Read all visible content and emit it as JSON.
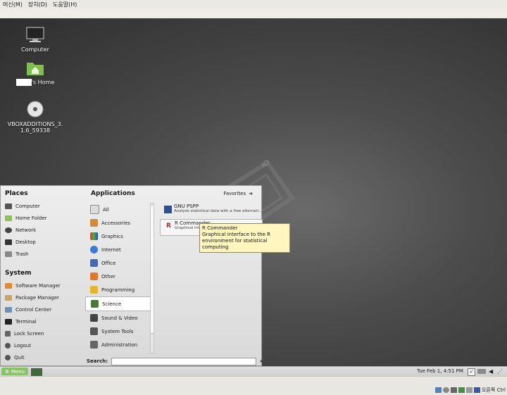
{
  "vbox_menu": [
    "머신(M)",
    "장치(D)",
    "도움말(H)"
  ],
  "desktop_icons": [
    {
      "label": "Computer",
      "icon": "monitor-icon"
    },
    {
      "label": "'s Home",
      "icon": "home-folder-icon"
    },
    {
      "label": "VBOXADDITIONS_3.1.6_59338",
      "icon": "cd-icon"
    }
  ],
  "places": {
    "title": "Places",
    "items": [
      {
        "label": "Computer",
        "icon": "computer-icon"
      },
      {
        "label": "Home Folder",
        "icon": "home-folder-icon"
      },
      {
        "label": "Network",
        "icon": "network-icon"
      },
      {
        "label": "Desktop",
        "icon": "desktop-icon"
      },
      {
        "label": "Trash",
        "icon": "trash-icon"
      }
    ]
  },
  "system": {
    "title": "System",
    "items": [
      {
        "label": "Software Manager",
        "icon": "software-manager-icon"
      },
      {
        "label": "Package Manager",
        "icon": "package-manager-icon"
      },
      {
        "label": "Control Center",
        "icon": "control-center-icon"
      },
      {
        "label": "Terminal",
        "icon": "terminal-icon"
      },
      {
        "label": "Lock Screen",
        "icon": "lock-icon"
      },
      {
        "label": "Logout",
        "icon": "logout-icon"
      },
      {
        "label": "Quit",
        "icon": "quit-icon"
      }
    ]
  },
  "applications": {
    "title": "Applications",
    "favorites_label": "Favorites",
    "categories": [
      {
        "label": "All",
        "selected": false
      },
      {
        "label": "Accessories",
        "selected": false
      },
      {
        "label": "Graphics",
        "selected": false
      },
      {
        "label": "Internet",
        "selected": false
      },
      {
        "label": "Office",
        "selected": false
      },
      {
        "label": "Other",
        "selected": false
      },
      {
        "label": "Programming",
        "selected": false
      },
      {
        "label": "Science",
        "selected": true
      },
      {
        "label": "Sound & Video",
        "selected": false
      },
      {
        "label": "System Tools",
        "selected": false
      },
      {
        "label": "Administration",
        "selected": false
      }
    ],
    "apps": [
      {
        "name": "GNU PSPP",
        "description": "Analyze statistical data with a free alternati...",
        "icon": "pspp-icon"
      },
      {
        "name": "R Commander",
        "description": "Graphical int...",
        "icon": "r-commander-icon"
      }
    ],
    "search_label": "Search:",
    "search_value": ""
  },
  "tooltip": {
    "title": "R Commander",
    "text": "Graphical interface to the R environment for statistical computing"
  },
  "panel": {
    "menu_label": "Menu",
    "clock": "Tue Feb  1,  4:51 PM"
  },
  "status_bar": {
    "host_key": "오른쪽 Ctrl"
  },
  "colors": {
    "menu_button": "#8ac26a",
    "tooltip_bg": "#fff6bf"
  }
}
